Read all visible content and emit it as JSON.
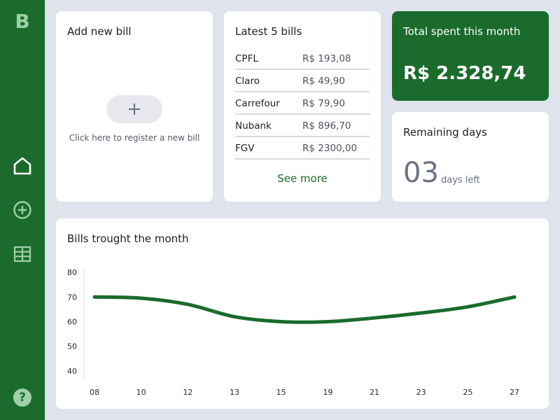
{
  "app": {
    "logo": "B"
  },
  "sidebar": {
    "items": [
      {
        "icon": "home-icon"
      },
      {
        "icon": "plus-circle-icon"
      },
      {
        "icon": "table-icon"
      }
    ],
    "help": "?"
  },
  "add_bill": {
    "title": "Add new bill",
    "hint": "Click here to register a new bill"
  },
  "latest_bills": {
    "title": "Latest 5 bills",
    "items": [
      {
        "name": "CPFL",
        "value": "R$ 193,08"
      },
      {
        "name": "Claro",
        "value": "R$ 49,90"
      },
      {
        "name": "Carrefour",
        "value": "R$ 79,90"
      },
      {
        "name": "Nubank",
        "value": "R$ 896,70"
      },
      {
        "name": "FGV",
        "value": "R$ 2300,00"
      }
    ],
    "see_more": "See more"
  },
  "total": {
    "title": "Total spent this month",
    "value": "R$ 2.328,74"
  },
  "remaining": {
    "title": "Remaining days",
    "number": "03",
    "label": "days left"
  },
  "chart": {
    "title": "Bills trought the month"
  },
  "colors": {
    "brand": "#1a6b2c",
    "background": "#dfe3ec",
    "line": "#1a6b2c"
  },
  "chart_data": {
    "type": "line",
    "title": "Bills trought the month",
    "xlabel": "",
    "ylabel": "",
    "x_ticks": [
      "08",
      "10",
      "12",
      "13",
      "15",
      "19",
      "21",
      "23",
      "25",
      "27"
    ],
    "y_ticks": [
      40,
      50,
      60,
      70,
      80
    ],
    "ylim": [
      36,
      82
    ],
    "grid": false,
    "series": [
      {
        "values": [
          {
            "x": "08",
            "y": 70
          },
          {
            "x": "10",
            "y": 69.5
          },
          {
            "x": "12",
            "y": 67
          },
          {
            "x": "13",
            "y": 62
          },
          {
            "x": "15",
            "y": 60
          },
          {
            "x": "19",
            "y": 60
          },
          {
            "x": "21",
            "y": 61.5
          },
          {
            "x": "23",
            "y": 63.5
          },
          {
            "x": "25",
            "y": 66
          },
          {
            "x": "27",
            "y": 70
          }
        ]
      }
    ]
  }
}
